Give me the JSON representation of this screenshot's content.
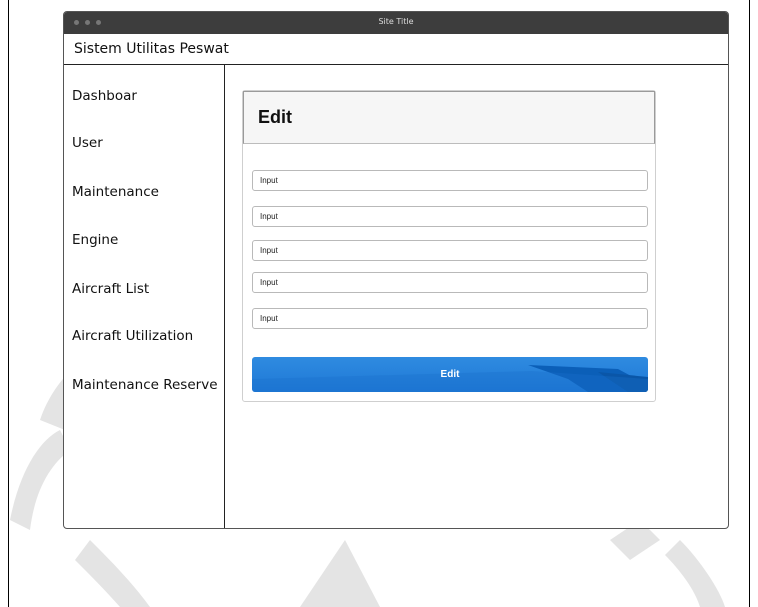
{
  "window": {
    "title": "Site Title"
  },
  "app": {
    "name": "Sistem Utilitas Peswat"
  },
  "sidebar": {
    "items": [
      {
        "label": "Dashboar"
      },
      {
        "label": "User"
      },
      {
        "label": "Maintenance"
      },
      {
        "label": "Engine"
      },
      {
        "label": "Aircraft List"
      },
      {
        "label": "Aircraft Utilization"
      },
      {
        "label": "Maintenance Reserve"
      }
    ]
  },
  "form": {
    "title": "Edit",
    "fields": [
      {
        "placeholder": "Input"
      },
      {
        "placeholder": "Input"
      },
      {
        "placeholder": "Input"
      },
      {
        "placeholder": "Input"
      },
      {
        "placeholder": "Input"
      }
    ],
    "submit_label": "Edit"
  },
  "colors": {
    "titlebar": "#3d3d3d",
    "button": "#1e78d6",
    "watermark": "#e6e6e6"
  }
}
